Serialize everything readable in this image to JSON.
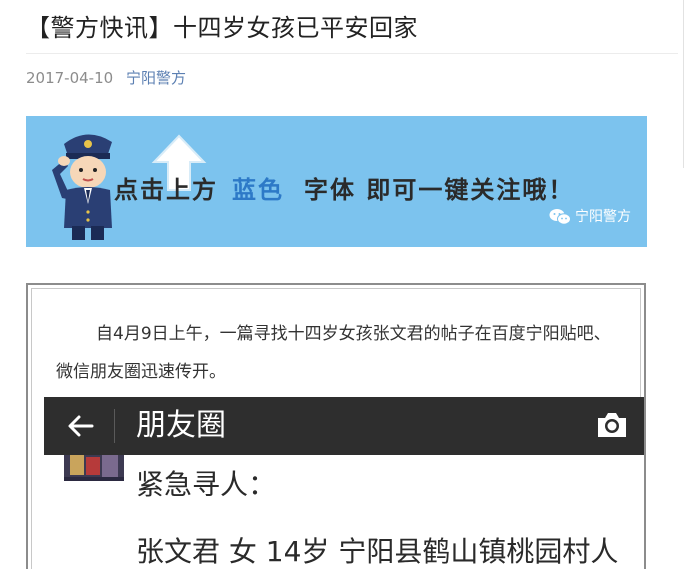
{
  "article": {
    "title": "【警方快讯】十四岁女孩已平安回家",
    "date": "2017-04-10",
    "author": "宁阳警方"
  },
  "banner": {
    "text_before": "点击上方",
    "text_blue": "蓝色",
    "text_after": "字体 即可一键关注哦！",
    "watermark": "宁阳警方",
    "colors": {
      "background": "#7cc3ee",
      "highlight": "#2d79c7"
    }
  },
  "body": {
    "paragraph": "自4月9日上午，一篇寻找十四岁女孩张文君的帖子在百度宁阳贴吧、微信朋友圈迅速传开。"
  },
  "screenshot": {
    "back_icon": "back-arrow-icon",
    "title": "朋友圈",
    "camera_icon": "camera-icon",
    "line1": "紧急寻人：",
    "line2": "张文君 女 14岁 宁阳县鹤山镇桃园村人"
  }
}
